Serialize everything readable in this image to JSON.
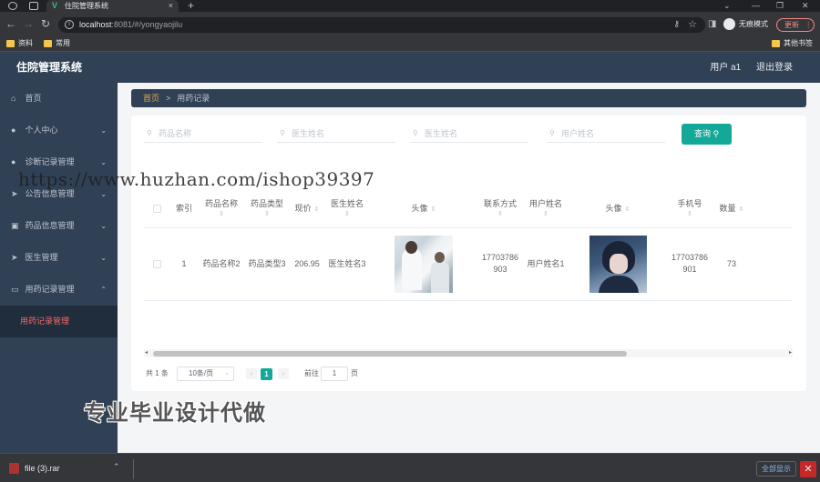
{
  "browser": {
    "tab_title": "住院管理系统",
    "tab_logo": "V",
    "tab_close": "×",
    "new_tab": "+",
    "window_controls": [
      "⌄",
      "—",
      "❐",
      "✕"
    ],
    "url_host": "localhost",
    "url_rest": ":8081/#/yongyaojilu",
    "incognito_label": "无痕模式",
    "update_label": "更新",
    "bookmarks": [
      "资料",
      "常用"
    ],
    "other_bookmarks": "其他书签"
  },
  "app": {
    "title": "住院管理系统",
    "user_label": "用户 a1",
    "logout_label": "退出登录"
  },
  "sidebar": {
    "items": [
      {
        "label": "首页",
        "icon": "home-icon",
        "glyph": "⌂",
        "chevron": ""
      },
      {
        "label": "个人中心",
        "icon": "user-icon",
        "glyph": "●",
        "chevron": "⌄"
      },
      {
        "label": "诊断记录管理",
        "icon": "user-icon",
        "glyph": "●",
        "chevron": "⌄"
      },
      {
        "label": "公告信息管理",
        "icon": "send-icon",
        "glyph": "➤",
        "chevron": "⌄"
      },
      {
        "label": "药品信息管理",
        "icon": "box-icon",
        "glyph": "▣",
        "chevron": "⌄"
      },
      {
        "label": "医生管理",
        "icon": "send-icon",
        "glyph": "➤",
        "chevron": "⌄"
      },
      {
        "label": "用药记录管理",
        "icon": "message-icon",
        "glyph": "▭",
        "chevron": "⌃"
      }
    ],
    "sub_item": "用药记录管理"
  },
  "breadcrumb": {
    "home": "首页",
    "separator": ">",
    "current": "用药记录"
  },
  "search": {
    "fields": [
      "药品名称",
      "医生姓名",
      "医生姓名",
      "用户姓名"
    ],
    "query_label": "查询"
  },
  "table": {
    "headers": [
      "索引",
      "药品名称",
      "药品类型",
      "现价",
      "医生姓名",
      "头像",
      "联系方式",
      "用户姓名",
      "头像",
      "手机号",
      "数量"
    ],
    "rows": [
      {
        "index": "1",
        "drug_name": "药品名称2",
        "drug_type": "药品类型3",
        "price": "206.95",
        "doctor_name": "医生姓名3",
        "contact": "17703786903",
        "user_name": "用户姓名1",
        "phone": "17703786901",
        "quantity": "73"
      }
    ]
  },
  "pagination": {
    "total": "共 1 条",
    "page_size": "10条/页",
    "current_page": "1",
    "goto_label": "前往",
    "goto_value": "1",
    "page_suffix": "页"
  },
  "overlay": {
    "watermark": "https://www.huzhan.com/ishop39397",
    "ad_text": "专业毕业设计代做"
  },
  "download": {
    "file_name": "file (3).rar",
    "show_all": "全部显示"
  }
}
